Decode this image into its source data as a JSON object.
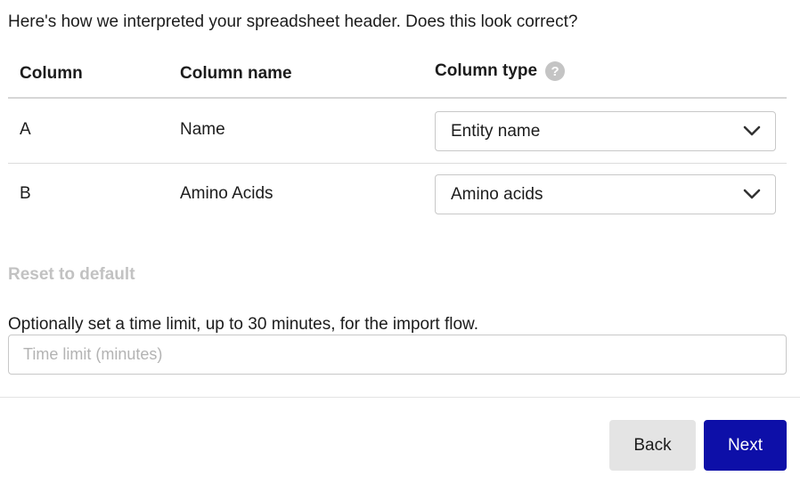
{
  "intro_text": "Here's how we interpreted your spreadsheet header. Does this look correct?",
  "table": {
    "headers": {
      "column": "Column",
      "column_name": "Column name",
      "column_type": "Column type",
      "help_icon": "?"
    },
    "rows": [
      {
        "column": "A",
        "name": "Name",
        "type": "Entity name"
      },
      {
        "column": "B",
        "name": "Amino Acids",
        "type": "Amino acids"
      }
    ]
  },
  "reset_label": "Reset to default",
  "time_limit": {
    "label": "Optionally set a time limit, up to 30 minutes, for the import flow.",
    "placeholder": "Time limit (minutes)",
    "value": ""
  },
  "footer": {
    "back_label": "Back",
    "next_label": "Next"
  },
  "colors": {
    "primary": "#0d0fa8",
    "secondary_button": "#e4e4e4",
    "disabled_text": "#c2c2c2",
    "help_icon_bg": "#c4c4c4"
  },
  "icons": {
    "help": "question-circle-icon",
    "dropdown": "chevron-down-icon"
  }
}
